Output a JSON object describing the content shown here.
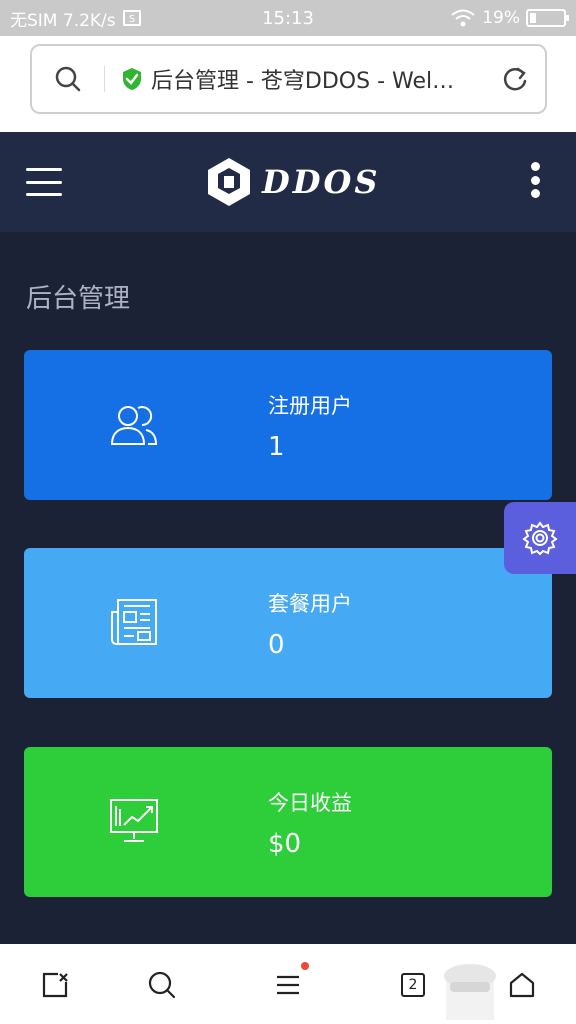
{
  "status_bar": {
    "left_text": "无SIM 7.2K/s",
    "time": "15:13",
    "battery_text": "19%",
    "battery_level": 0.19
  },
  "browser": {
    "page_title": "后台管理 - 苍穹DDOS - Wel…"
  },
  "header": {
    "logo_text": "DDOS"
  },
  "main": {
    "page_title": "后台管理",
    "cards": [
      {
        "label": "注册用户",
        "value": "1",
        "icon": "users-icon",
        "color": "#1570e6"
      },
      {
        "label": "套餐用户",
        "value": "0",
        "icon": "newspaper-icon",
        "color": "#46a9f3"
      },
      {
        "label": "今日收益",
        "value": "$0",
        "icon": "monitor-chart-icon",
        "color": "#2ecd3a"
      }
    ]
  },
  "floating": {
    "icon": "gear-icon",
    "color": "#5b5fdd"
  },
  "bottom_bar": {
    "tab_count": "2",
    "icons": [
      "close-tab-icon",
      "search-icon",
      "menu-icon",
      "tabs-icon",
      "home-icon"
    ]
  }
}
